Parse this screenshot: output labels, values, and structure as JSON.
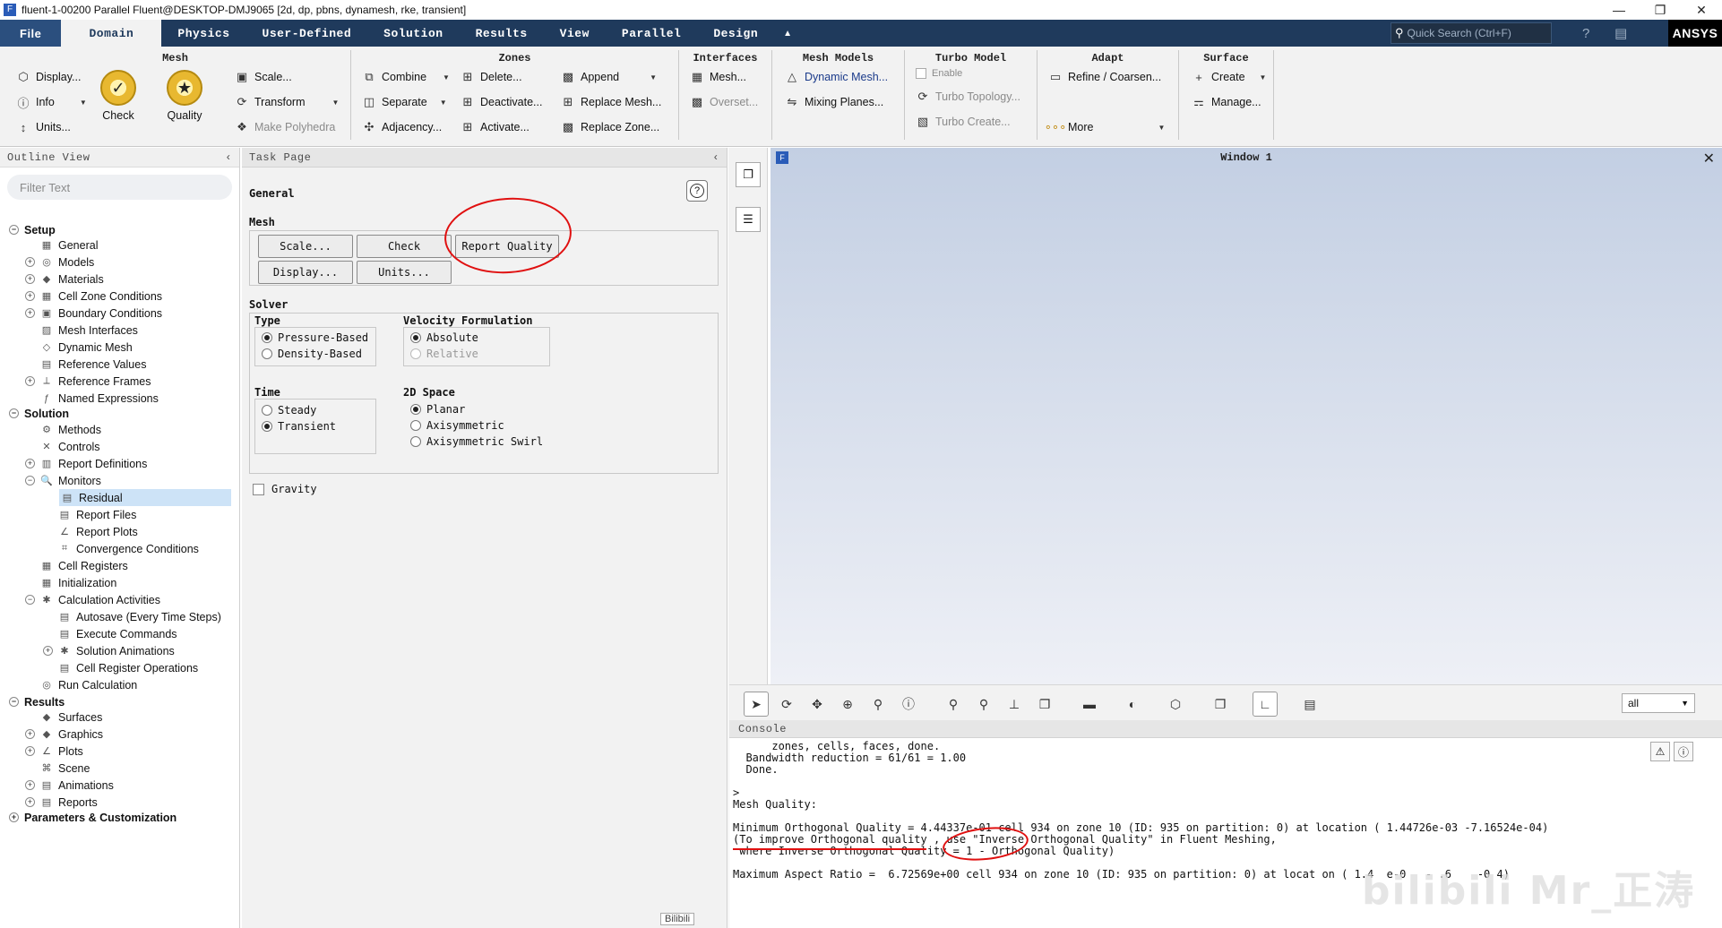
{
  "titlebar": {
    "text": "fluent-1-00200 Parallel Fluent@DESKTOP-DMJ9065  [2d, dp, pbns, dynamesh, rke, transient]",
    "app_icon": "F",
    "minimize": "—",
    "restore": "❐",
    "close": "✕"
  },
  "menubar": {
    "items": [
      "File",
      "Domain",
      "Physics",
      "User-Defined",
      "Solution",
      "Results",
      "View",
      "Parallel",
      "Design"
    ],
    "active": "Domain",
    "collapse_icon": "▲",
    "search_placeholder": "Quick Search (Ctrl+F)",
    "brand": "ANSYS"
  },
  "ribbon": {
    "mesh": {
      "title": "Mesh",
      "display": "Display...",
      "info": "Info",
      "units": "Units...",
      "check": "Check",
      "quality": "Quality",
      "scale": "Scale...",
      "transform": "Transform",
      "make_polyhedra": "Make Polyhedra"
    },
    "zones": {
      "title": "Zones",
      "combine": "Combine",
      "separate": "Separate",
      "adjacency": "Adjacency...",
      "delete": "Delete...",
      "deactivate": "Deactivate...",
      "activate": "Activate...",
      "append": "Append",
      "replace_mesh": "Replace Mesh...",
      "replace_zone": "Replace Zone..."
    },
    "interfaces": {
      "title": "Interfaces",
      "mesh": "Mesh...",
      "overset": "Overset..."
    },
    "mesh_models": {
      "title": "Mesh Models",
      "dynamic_mesh": "Dynamic Mesh...",
      "mixing_planes": "Mixing Planes..."
    },
    "turbo_model": {
      "title": "Turbo Model",
      "enable": "Enable",
      "turbo_topology": "Turbo Topology...",
      "turbo_create": "Turbo Create..."
    },
    "adapt": {
      "title": "Adapt",
      "refine": "Refine / Coarsen...",
      "more": "More"
    },
    "surface": {
      "title": "Surface",
      "create": "Create",
      "manage": "Manage..."
    }
  },
  "outline": {
    "title": "Outline View",
    "filter_placeholder": "Filter Text",
    "tree": [
      {
        "label": "Setup",
        "level": 0,
        "exp": "−",
        "section": true
      },
      {
        "label": "General",
        "level": 1,
        "icon": "▦"
      },
      {
        "label": "Models",
        "level": 1,
        "exp": "+",
        "icon": "◎"
      },
      {
        "label": "Materials",
        "level": 1,
        "exp": "+",
        "icon": "◆"
      },
      {
        "label": "Cell Zone Conditions",
        "level": 1,
        "exp": "+",
        "icon": "▦"
      },
      {
        "label": "Boundary Conditions",
        "level": 1,
        "exp": "+",
        "icon": "▣"
      },
      {
        "label": "Mesh Interfaces",
        "level": 1,
        "icon": "▨"
      },
      {
        "label": "Dynamic Mesh",
        "level": 1,
        "icon": "◇"
      },
      {
        "label": "Reference Values",
        "level": 1,
        "icon": "▤"
      },
      {
        "label": "Reference Frames",
        "level": 1,
        "exp": "+",
        "icon": "⟂"
      },
      {
        "label": "Named Expressions",
        "level": 1,
        "icon": "ƒ"
      },
      {
        "label": "Solution",
        "level": 0,
        "exp": "−",
        "section": true
      },
      {
        "label": "Methods",
        "level": 1,
        "icon": "⚙"
      },
      {
        "label": "Controls",
        "level": 1,
        "icon": "✕"
      },
      {
        "label": "Report Definitions",
        "level": 1,
        "exp": "+",
        "icon": "▥"
      },
      {
        "label": "Monitors",
        "level": 1,
        "exp": "−",
        "icon": "🔍"
      },
      {
        "label": "Residual",
        "level": 2,
        "icon": "▤",
        "selected": true
      },
      {
        "label": "Report Files",
        "level": 2,
        "icon": "▤"
      },
      {
        "label": "Report Plots",
        "level": 2,
        "icon": "∠"
      },
      {
        "label": "Convergence Conditions",
        "level": 2,
        "icon": "⌗"
      },
      {
        "label": "Cell Registers",
        "level": 1,
        "icon": "▦"
      },
      {
        "label": "Initialization",
        "level": 1,
        "icon": "▦"
      },
      {
        "label": "Calculation Activities",
        "level": 1,
        "exp": "−",
        "icon": "✱"
      },
      {
        "label": "Autosave (Every Time Steps)",
        "level": 2,
        "icon": "▤"
      },
      {
        "label": "Execute Commands",
        "level": 2,
        "icon": "▤"
      },
      {
        "label": "Solution Animations",
        "level": 2,
        "exp": "+",
        "icon": "✱"
      },
      {
        "label": "Cell Register Operations",
        "level": 2,
        "icon": "▤"
      },
      {
        "label": "Run Calculation",
        "level": 1,
        "icon": "◎"
      },
      {
        "label": "Results",
        "level": 0,
        "exp": "−",
        "section": true
      },
      {
        "label": "Surfaces",
        "level": 1,
        "icon": "◆"
      },
      {
        "label": "Graphics",
        "level": 1,
        "exp": "+",
        "icon": "◆"
      },
      {
        "label": "Plots",
        "level": 1,
        "exp": "+",
        "icon": "∠"
      },
      {
        "label": "Scene",
        "level": 1,
        "icon": "⌘"
      },
      {
        "label": "Animations",
        "level": 1,
        "exp": "+",
        "icon": "▤"
      },
      {
        "label": "Reports",
        "level": 1,
        "exp": "+",
        "icon": "▤"
      },
      {
        "label": "Parameters & Customization",
        "level": 0,
        "exp": "+",
        "section": true
      }
    ]
  },
  "taskpage": {
    "title": "Task Page",
    "heading": "General",
    "help_icon": "?",
    "mesh_label": "Mesh",
    "buttons": {
      "scale": "Scale...",
      "check": "Check",
      "report_quality": "Report Quality",
      "display": "Display...",
      "units": "Units..."
    },
    "solver_label": "Solver",
    "type_label": "Type",
    "type_options": [
      {
        "label": "Pressure-Based",
        "on": true
      },
      {
        "label": "Density-Based",
        "on": false
      }
    ],
    "velocity_label": "Velocity Formulation",
    "velocity_options": [
      {
        "label": "Absolute",
        "on": true
      },
      {
        "label": "Relative",
        "on": false,
        "disabled": true
      }
    ],
    "time_label": "Time",
    "time_options": [
      {
        "label": "Steady",
        "on": false
      },
      {
        "label": "Transient",
        "on": true
      }
    ],
    "space_label": "2D Space",
    "space_options": [
      {
        "label": "Planar",
        "on": true
      },
      {
        "label": "Axisymmetric",
        "on": false
      },
      {
        "label": "Axisymmetric Swirl",
        "on": false
      }
    ],
    "gravity_label": "Gravity",
    "gravity_checked": false
  },
  "graphics": {
    "title": "Window 1",
    "close": "✕",
    "selector_value": "all"
  },
  "console": {
    "title": "Console",
    "lines": [
      "      zones, cells, faces, done.",
      "  Bandwidth reduction = 61/61 = 1.00",
      "  Done.",
      "",
      ">",
      "Mesh Quality:",
      "",
      "Minimum Orthogonal Quality = 4.44337e-01 cell 934 on zone 10 (ID: 935 on partition: 0) at location ( 1.44726e-03 -7.16524e-04)",
      "(To improve Orthogonal quality , use \"Inverse Orthogonal Quality\" in Fluent Meshing,",
      " where Inverse Orthogonal Quality = 1 - Orthogonal Quality)",
      "",
      "Maximum Aspect Ratio =  6.72569e+00 cell 934 on zone 10 (ID: 935 on partition: 0) at locat on ( 1.4  e-0   - .6    -0 4)"
    ]
  },
  "watermark": "bilibili  Mr_正涛",
  "bili_badge": "Bilibili",
  "colors": {
    "menubar": "#1f3a5c",
    "annotation": "#e01010",
    "selection": "#cde3f7"
  }
}
